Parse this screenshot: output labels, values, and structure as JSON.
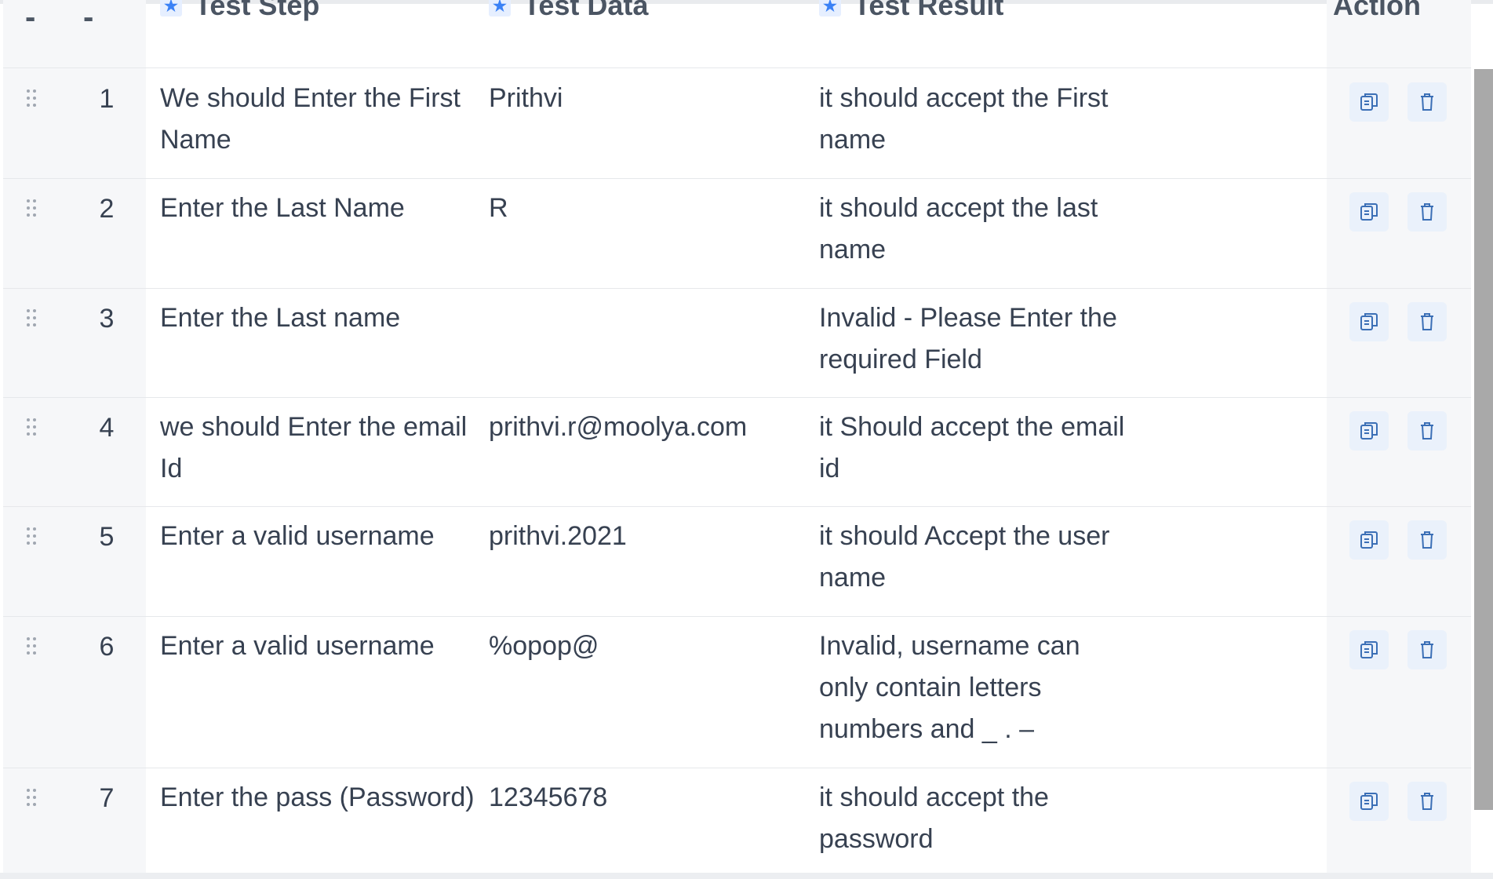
{
  "table": {
    "headers": {
      "drag_col": "-",
      "num_col": "-",
      "test_step": "Test Step",
      "test_data": "Test Data",
      "test_result": "Test Result",
      "action": "Action"
    },
    "pin_icon": "pin-icon",
    "rows": [
      {
        "num": "1",
        "step": "We should Enter the First Name",
        "data": "Prithvi",
        "result": "it should accept the First name"
      },
      {
        "num": "2",
        "step": "Enter the Last Name",
        "data": "R",
        "result": "it should accept the last name"
      },
      {
        "num": "3",
        "step": "Enter the Last name",
        "data": "",
        "result": "Invalid - Please Enter the required Field"
      },
      {
        "num": "4",
        "step": "we should Enter the email Id",
        "data": "prithvi.r@moolya.com",
        "result": "it Should accept the email id"
      },
      {
        "num": "5",
        "step": "Enter a valid username",
        "data": "prithvi.2021",
        "result": "it should Accept the user name"
      },
      {
        "num": "6",
        "step": "Enter a valid username",
        "data": "%opop@",
        "result": "Invalid, username can only contain letters numbers and _ . –"
      },
      {
        "num": "7",
        "step": "Enter the pass (Password)",
        "data": "12345678",
        "result": "it should accept the password"
      }
    ],
    "row_actions": [
      "copy-icon",
      "trash-icon"
    ]
  },
  "colors": {
    "text": "#374151",
    "header_text": "#4b5563",
    "side_column_bg": "#f6f7f9",
    "action_button_bg": "#eaf1fb",
    "action_icon": "#3b6fb6",
    "pin_icon": "#3b82f6",
    "scrollbar_thumb": "#a9a9a9"
  }
}
